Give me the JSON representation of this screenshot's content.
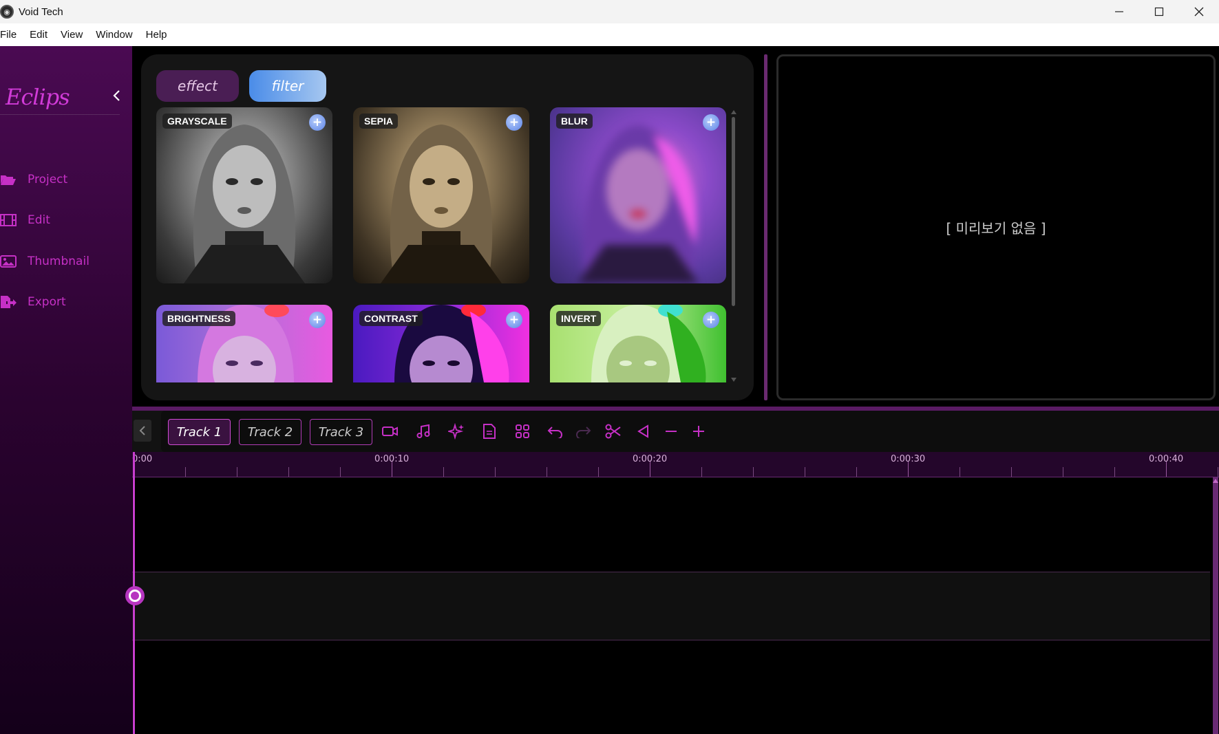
{
  "window": {
    "title": "Void Tech"
  },
  "menu": {
    "items": [
      "File",
      "Edit",
      "View",
      "Window",
      "Help"
    ]
  },
  "sidebar": {
    "logo": "Eclips",
    "items": [
      {
        "label": "Project",
        "icon": "folder-open-icon"
      },
      {
        "label": "Edit",
        "icon": "film-icon"
      },
      {
        "label": "Thumbnail",
        "icon": "image-icon"
      },
      {
        "label": "Export",
        "icon": "export-icon"
      }
    ]
  },
  "fx_panel": {
    "tabs": [
      {
        "label": "effect",
        "active": false
      },
      {
        "label": "filter",
        "active": true
      }
    ],
    "filters": [
      {
        "label": "GRAYSCALE"
      },
      {
        "label": "SEPIA"
      },
      {
        "label": "BLUR"
      },
      {
        "label": "BRIGHTNESS"
      },
      {
        "label": "CONTRAST"
      },
      {
        "label": "INVERT"
      }
    ],
    "add_label": "+"
  },
  "preview": {
    "empty_text": "[ 미리보기 없음 ]"
  },
  "timeline": {
    "tracks": [
      {
        "label": "Track 1",
        "active": true
      },
      {
        "label": "Track 2",
        "active": false
      },
      {
        "label": "Track 3",
        "active": false
      }
    ],
    "tools": [
      "video-icon",
      "music-icon",
      "sparkle-icon",
      "document-icon",
      "grid-icon",
      "undo-icon",
      "redo-icon",
      "scissors-icon",
      "trim-icon",
      "zoom-out-icon",
      "zoom-in-icon"
    ],
    "ruler_labels": [
      "0:00",
      "0:00:10",
      "0:00:20",
      "0:00:30",
      "0:00:40"
    ]
  },
  "colors": {
    "accent": "#c630c6",
    "filter_tab": "#5b8fe8",
    "sidebar_top": "#4a0a52",
    "ruler_bg": "#24062b"
  }
}
